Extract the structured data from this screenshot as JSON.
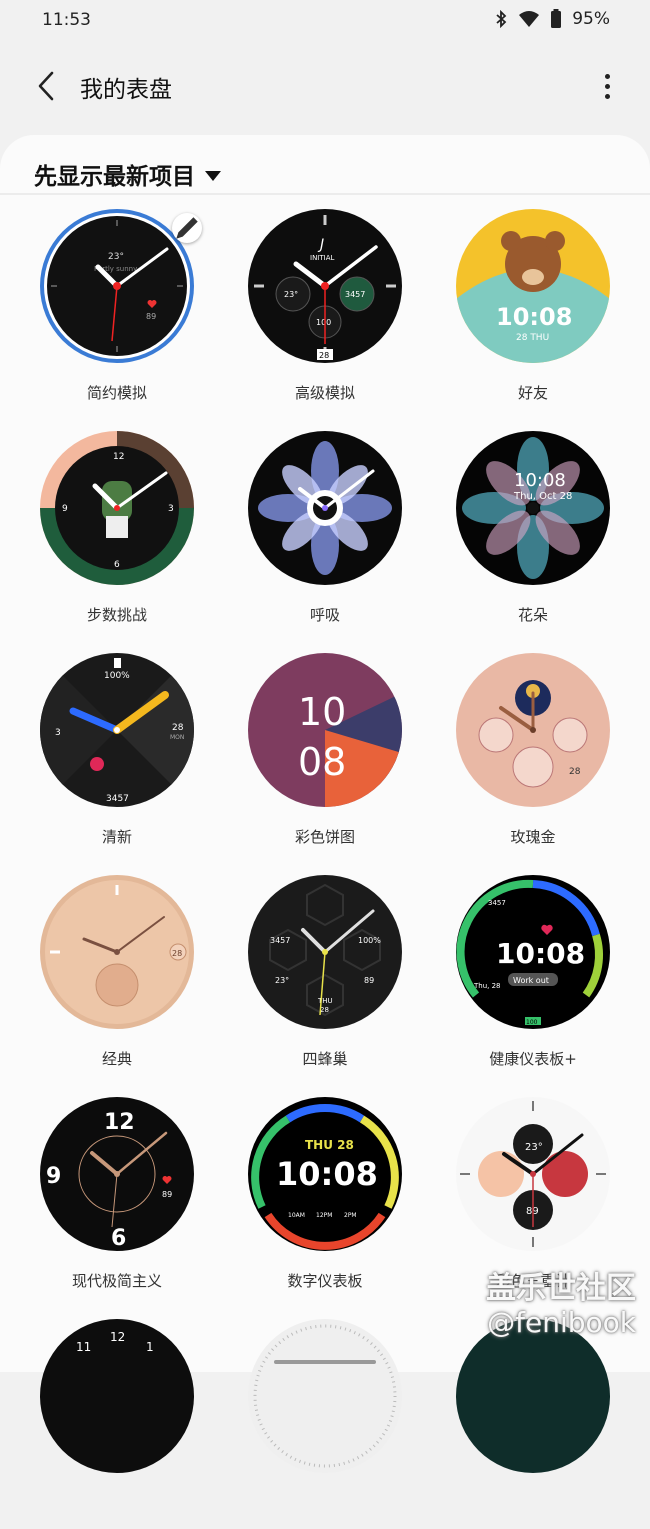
{
  "status_bar": {
    "time": "11:53",
    "battery": "95%"
  },
  "app_bar": {
    "title": "我的表盘"
  },
  "filter": {
    "label": "先显示最新项目"
  },
  "faces": [
    {
      "label": "简约模拟",
      "weather": "23°",
      "weather_sub": "Partly sunny",
      "heart": "89",
      "selected": true
    },
    {
      "label": "高级模拟",
      "brand": "INITIAL",
      "temp": "23°",
      "steps": "3457",
      "battery": "100",
      "date": "28"
    },
    {
      "label": "好友",
      "time": "10:08",
      "date": "28 THU"
    },
    {
      "label": "步数挑战"
    },
    {
      "label": "呼吸"
    },
    {
      "label": "花朵",
      "time": "10:08",
      "date": "Thu, Oct 28"
    },
    {
      "label": "清新",
      "battery": "100%",
      "date": "28",
      "day": "MON",
      "steps": "3457",
      "count": "3"
    },
    {
      "label": "彩色饼图",
      "hour": "10",
      "minute": "08"
    },
    {
      "label": "玫瑰金",
      "date": "28"
    },
    {
      "label": "经典",
      "date": "28"
    },
    {
      "label": "四蜂巢",
      "steps": "3457",
      "battery": "100%",
      "temp": "23°",
      "heart": "89",
      "day": "THU",
      "date": "28"
    },
    {
      "label": "健康仪表板+",
      "time": "10:08",
      "status": "Work out",
      "steps": "3457",
      "day": "Thu, 28",
      "battery": "100"
    },
    {
      "label": "现代极简主义",
      "twelve": "12",
      "nine": "9",
      "six": "6",
      "heart": "89"
    },
    {
      "label": "数字仪表板",
      "date": "THU 28",
      "time": "10:08",
      "t1": "10AM",
      "t2": "12PM",
      "t3": "2PM"
    },
    {
      "label": "彩色三重计",
      "temp": "23°",
      "heart": "89"
    }
  ],
  "watermark": {
    "line1": "盖乐世社区",
    "line2": "@fenibook"
  },
  "colors": {
    "accent": "#3a7bd5",
    "background": "#f1f1f1",
    "sheet": "#fbfbfb"
  }
}
